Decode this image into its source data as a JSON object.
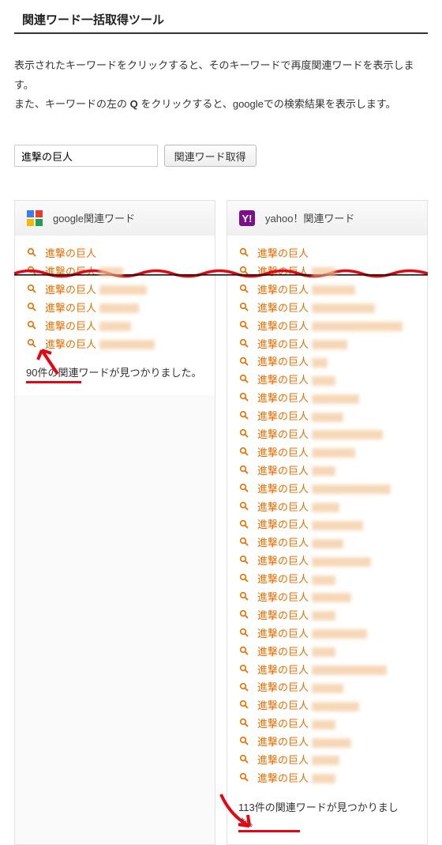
{
  "title": "関連ワード一括取得ツール",
  "description_line1": "表示されたキーワードをクリックすると、そのキーワードで再度関連ワードを表示します。",
  "description_line2_prefix": "また、キーワードの左の ",
  "description_line2_q": "Q",
  "description_line2_suffix": " をクリックすると、googleでの検索結果を表示します。",
  "search": {
    "value": "進撃の巨人",
    "button": "関連ワード取得"
  },
  "google_panel": {
    "header": "google関連ワード",
    "keywords": [
      "進撃の巨人",
      "進撃の巨人",
      "進撃の巨人",
      "進撃の巨人",
      "進撃の巨人",
      "進撃の巨人"
    ],
    "result_count": "90件の関連ワードが見つかりました。"
  },
  "yahoo_panel": {
    "header": "yahoo！関連ワード",
    "keywords": [
      "進撃の巨人",
      "進撃の巨人",
      "進撃の巨人",
      "進撃の巨人",
      "進撃の巨人",
      "進撃の巨人",
      "進撃の巨人",
      "進撃の巨人",
      "進撃の巨人",
      "進撃の巨人",
      "進撃の巨人",
      "進撃の巨人",
      "進撃の巨人",
      "進撃の巨人",
      "進撃の巨人",
      "進撃の巨人",
      "進撃の巨人",
      "進撃の巨人",
      "進撃の巨人",
      "進撃の巨人",
      "進撃の巨人",
      "進撃の巨人",
      "進撃の巨人",
      "進撃の巨人",
      "進撃の巨人",
      "進撃の巨人",
      "進撃の巨人",
      "進撃の巨人",
      "進撃の巨人",
      "進撃の巨人"
    ],
    "result_count": "113件の関連ワードが見つかりました。"
  },
  "blur_widths_google": [
    0,
    30,
    60,
    50,
    40,
    70
  ],
  "blur_widths_yahoo": [
    0,
    30,
    55,
    80,
    115,
    45,
    20,
    30,
    60,
    40,
    90,
    55,
    30,
    100,
    35,
    65,
    40,
    75,
    30,
    50,
    30,
    70,
    30,
    95,
    40,
    60,
    30,
    50,
    35,
    30
  ]
}
